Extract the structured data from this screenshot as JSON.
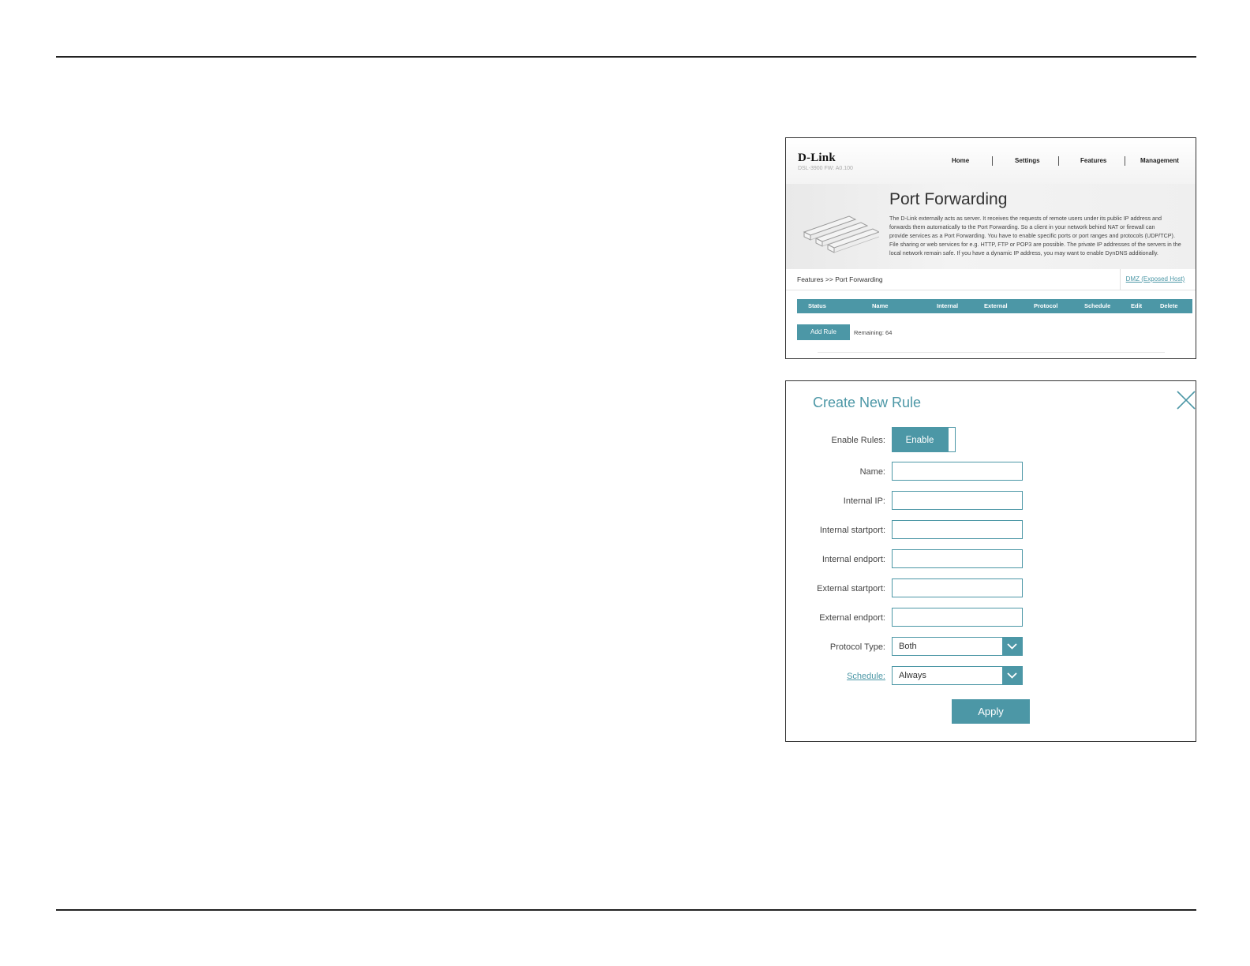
{
  "screenshot1": {
    "logo": "D-Link",
    "model": "DSL-3900  FW: A0.100",
    "nav": [
      "Home",
      "Settings",
      "Features",
      "Management"
    ],
    "title": "Port Forwarding",
    "description_lines": [
      "The D-Link externally acts as server. It receives the requests of remote users under its public IP address and",
      "forwards them automatically to the Port Forwarding. So a client in your network behind NAT or firewall can",
      "provide services as a Port Forwarding. You have to enable specific ports or port ranges and protocols (UDP/TCP).",
      "File sharing or web services for e.g. HTTP, FTP or POP3 are possible. The private IP addresses of the servers in the",
      "local network remain safe. If you have a dynamic IP address, you may want to enable DynDNS additionally."
    ],
    "breadcrumb": "Features >> Port Forwarding",
    "dmz_link": "DMZ (Exposed Host)",
    "table_headers": [
      "Status",
      "Name",
      "Internal",
      "External",
      "Protocol",
      "Schedule",
      "Edit",
      "Delete"
    ],
    "add_rule_label": "Add Rule",
    "remaining_text": "Remaining: 64"
  },
  "screenshot2": {
    "title": "Create New Rule",
    "enable_rules_label": "Enable Rules:",
    "enable_value": "Enable",
    "fields": [
      {
        "label": "Name:",
        "value": ""
      },
      {
        "label": "Internal IP:",
        "value": ""
      },
      {
        "label": "Internal startport:",
        "value": ""
      },
      {
        "label": "Internal endport:",
        "value": ""
      },
      {
        "label": "External startport:",
        "value": ""
      },
      {
        "label": "External endport:",
        "value": ""
      }
    ],
    "protocol_label": "Protocol Type:",
    "protocol_value": "Both",
    "schedule_label": "Schedule:",
    "schedule_value": "Always",
    "apply_label": "Apply"
  },
  "colors": {
    "accent": "#4c97a6"
  }
}
